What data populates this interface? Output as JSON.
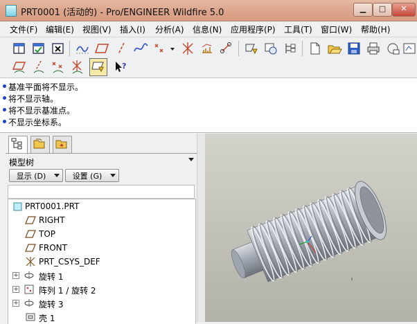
{
  "window": {
    "title": "PRT0001 (活动的) - Pro/ENGINEER Wildfire 5.0",
    "controls": [
      "minimize",
      "maximize",
      "close"
    ]
  },
  "menubar": {
    "items": [
      {
        "label": "文件(F)"
      },
      {
        "label": "编辑(E)"
      },
      {
        "label": "视图(V)"
      },
      {
        "label": "插入(I)"
      },
      {
        "label": "分析(A)"
      },
      {
        "label": "信息(N)"
      },
      {
        "label": "应用程序(P)"
      },
      {
        "label": "工具(T)"
      },
      {
        "label": "窗口(W)"
      },
      {
        "label": "帮助(H)"
      }
    ]
  },
  "toolbar": {
    "row1_icons": [
      "window-layout-icon",
      "check-window-icon",
      "close-window-icon",
      "sketch-curve-icon",
      "datum-plane-icon",
      "datum-axis-icon",
      "spline-curve-icon",
      "datum-point-icon",
      "point-dropdown-icon",
      "coordinate-system-icon",
      "analysis-feature-icon",
      "pattern-link-icon",
      "relation-icon",
      "family-table-icon",
      "feature-tree-icon",
      "new-file-icon",
      "open-file-icon",
      "save-icon",
      "print-icon",
      "email-icon",
      "repaint-icon"
    ],
    "row2_icons": [
      "plane-display-icon",
      "axis-display-icon",
      "point-display-icon",
      "csys-display-icon",
      "annotation-display-icon",
      "context-help-icon"
    ]
  },
  "messages": [
    "基准平面将不显示。",
    "将不显示轴。",
    "将不显示基准点。",
    "不显示坐标系。"
  ],
  "colors": {
    "titlebar": "#dba58b",
    "message_bullet": "#1d3fd0",
    "model": "#9ea4ae",
    "graphics_bg": "#c4c4bc"
  },
  "navigator": {
    "tabs": [
      "model-tree-tab",
      "folder-browser-tab",
      "favorites-tab"
    ],
    "tree_label": "模型树",
    "show_button": "显示 (D)",
    "settings_button": "设置 (G)",
    "tree": [
      {
        "label": "PRT0001.PRT",
        "icon": "part-icon",
        "expandable": false,
        "indent": 0
      },
      {
        "label": "RIGHT",
        "icon": "datum-plane-icon",
        "expandable": false,
        "indent": 1
      },
      {
        "label": "TOP",
        "icon": "datum-plane-icon",
        "expandable": false,
        "indent": 1
      },
      {
        "label": "FRONT",
        "icon": "datum-plane-icon",
        "expandable": false,
        "indent": 1
      },
      {
        "label": "PRT_CSYS_DEF",
        "icon": "csys-icon",
        "expandable": false,
        "indent": 1
      },
      {
        "label": "旋转 1",
        "icon": "revolve-icon",
        "expandable": true,
        "indent": 1
      },
      {
        "label": "阵列 1 / 旋转 2",
        "icon": "pattern-icon",
        "expandable": true,
        "indent": 1
      },
      {
        "label": "旋转 3",
        "icon": "revolve-icon",
        "expandable": true,
        "indent": 1
      },
      {
        "label": "壳 1",
        "icon": "shell-icon",
        "expandable": false,
        "indent": 1
      }
    ]
  }
}
